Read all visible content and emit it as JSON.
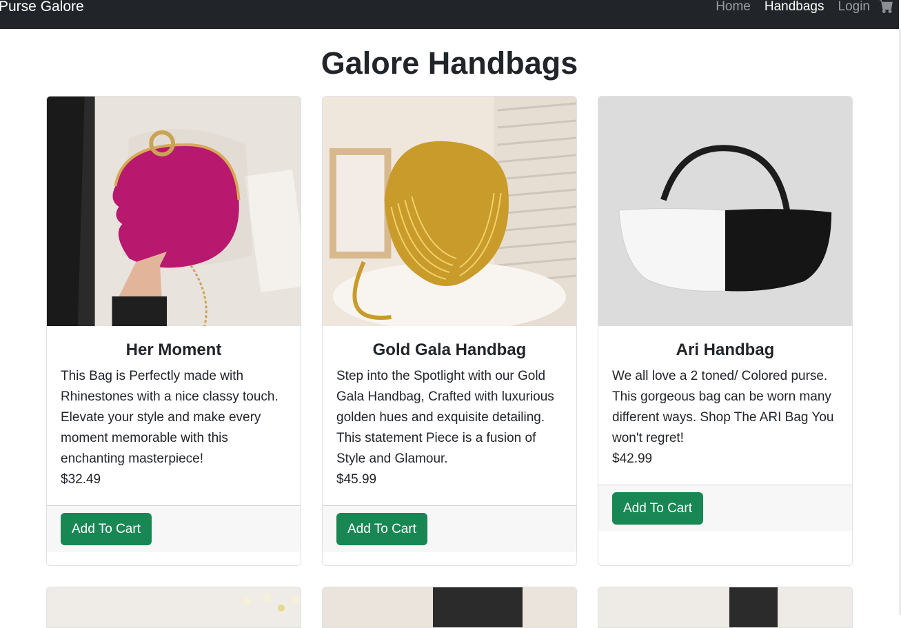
{
  "nav": {
    "brand": "Purse Galore",
    "links": [
      "Home",
      "Handbags",
      "Login"
    ],
    "active": "Handbags",
    "cart_icon": "cart-icon"
  },
  "page": {
    "title": "Galore Handbags"
  },
  "products": [
    {
      "title": "Her Moment",
      "description": "This Bag is Perfectly made with Rhinestones with a nice classy touch. Elevate your style and make every moment memorable with this enchanting masterpiece!",
      "price": "$32.49",
      "button": "Add To Cart"
    },
    {
      "title": "Gold Gala Handbag",
      "description": "Step into the Spotlight with our Gold Gala Handbag, Crafted with luxurious golden hues and exquisite detailing. This statement Piece is a fusion of Style and Glamour.",
      "price": "$45.99",
      "button": "Add To Cart"
    },
    {
      "title": "Ari Handbag",
      "description": "We all love a 2 toned/ Colored purse. This gorgeous bag can be worn many different ways. Shop The ARI Bag You won't regret!",
      "price": "$42.99",
      "button": "Add To Cart"
    }
  ],
  "colors": {
    "navbar": "#212529",
    "button": "#198754"
  }
}
